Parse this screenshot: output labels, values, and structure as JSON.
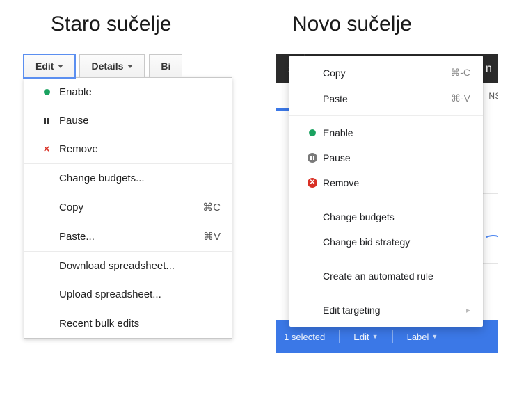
{
  "headings": {
    "old": "Staro sučelje",
    "new": "Novo sučelje"
  },
  "old": {
    "toolbar": {
      "edit": "Edit",
      "details": "Details",
      "bid_cut": "Bi"
    },
    "menu": {
      "enable": "Enable",
      "pause": "Pause",
      "remove": "Remove",
      "change_budgets": "Change budgets...",
      "copy": "Copy",
      "copy_shortcut": "⌘C",
      "paste": "Paste...",
      "paste_shortcut": "⌘V",
      "download_spreadsheet": "Download spreadsheet...",
      "upload_spreadsheet": "Upload spreadsheet...",
      "recent_bulk_edits": "Recent bulk edits"
    }
  },
  "new": {
    "header_tag_letter": "n",
    "tabs_fragment": "NS",
    "menu": {
      "copy": "Copy",
      "copy_shortcut": "⌘-C",
      "paste": "Paste",
      "paste_shortcut": "⌘-V",
      "enable": "Enable",
      "pause": "Pause",
      "remove": "Remove",
      "change_budgets": "Change budgets",
      "change_bid_strategy": "Change bid strategy",
      "create_automated_rule": "Create an automated rule",
      "edit_targeting": "Edit targeting"
    },
    "footer": {
      "selected": "1 selected",
      "edit": "Edit",
      "label": "Label"
    }
  }
}
